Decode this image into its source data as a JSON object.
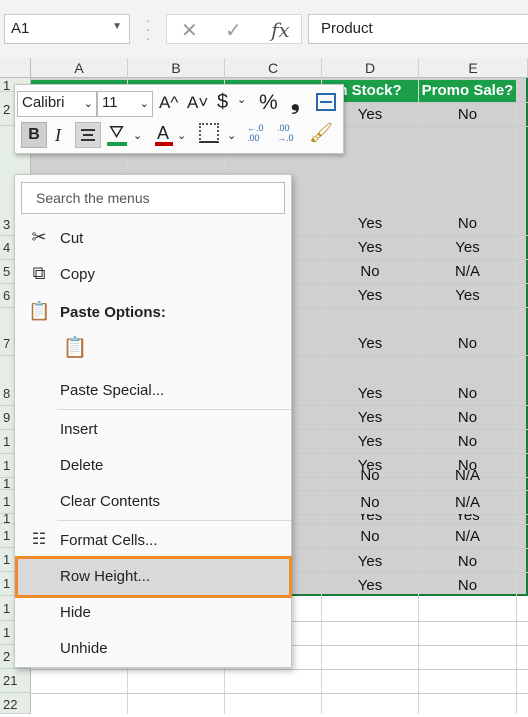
{
  "formula_bar": {
    "name_box": "A1",
    "fx": "fx",
    "value": "Product",
    "cancel_glyph": "✕",
    "enter_glyph": "✓"
  },
  "columns": [
    "A",
    "B",
    "C",
    "D",
    "E"
  ],
  "headers": {
    "d": "n Stock?",
    "e": "Promo Sale?"
  },
  "rows": [
    {
      "num": "1",
      "d": "",
      "e": ""
    },
    {
      "num": "2",
      "d": "Yes",
      "e": "No"
    },
    {
      "num": "3",
      "d": "Yes",
      "e": "No"
    },
    {
      "num": "4",
      "d": "Yes",
      "e": "Yes"
    },
    {
      "num": "5",
      "d": "No",
      "e": "N/A"
    },
    {
      "num": "6",
      "d": "Yes",
      "e": "Yes"
    },
    {
      "num": "7",
      "d": "Yes",
      "e": "No"
    },
    {
      "num": "8",
      "d": "Yes",
      "e": "No"
    },
    {
      "num": "9",
      "d": "Yes",
      "e": "No"
    },
    {
      "num": "1",
      "d": "Yes",
      "e": "No"
    },
    {
      "num": "1",
      "d": "Yes",
      "e": "No"
    },
    {
      "num": "1",
      "d": "No",
      "e": "N/A"
    },
    {
      "num": "1",
      "d": "No",
      "e": "N/A"
    },
    {
      "num": "1",
      "d": "Yes",
      "e": "Yes"
    },
    {
      "num": "1",
      "d": "No",
      "e": "N/A"
    },
    {
      "num": "1",
      "d": "Yes",
      "e": "No"
    },
    {
      "num": "1",
      "d": "Yes",
      "e": "No"
    },
    {
      "num": "1",
      "d": "",
      "e": ""
    },
    {
      "num": "1",
      "d": "",
      "e": ""
    },
    {
      "num": "2",
      "d": "",
      "e": ""
    },
    {
      "num": "21",
      "d": "",
      "e": ""
    },
    {
      "num": "22",
      "d": "",
      "e": ""
    }
  ],
  "mini_toolbar": {
    "font": "Calibri",
    "size": "11",
    "grow": "A^",
    "shrink": "A˅",
    "currency": "$",
    "percent": "%",
    "comma": "❟",
    "bold": "B",
    "italic": "I",
    "font_color_letter": "A",
    "dec_inc": "←.0\n.00",
    "dec_dec": ".00\n→.0",
    "accent_green": "#1a9e48",
    "accent_red": "#c00000"
  },
  "context_menu": {
    "search_placeholder": "Search the menus",
    "cut": "Cut",
    "copy": "Copy",
    "paste_options": "Paste Options:",
    "paste_special": "Paste Special...",
    "insert": "Insert",
    "delete": "Delete",
    "clear_contents": "Clear Contents",
    "format_cells": "Format Cells...",
    "row_height": "Row Height...",
    "hide": "Hide",
    "unhide": "Unhide"
  },
  "colors": {
    "header_green": "#1a9e48",
    "selection_fill": "#d0d0d0",
    "highlight_orange": "#f18a2b"
  },
  "icons": [
    "scissors-icon",
    "copy-icon",
    "clipboard-icon",
    "format-cells-icon",
    "paintbrush-icon",
    "borders-icon",
    "fill-bucket-icon"
  ]
}
